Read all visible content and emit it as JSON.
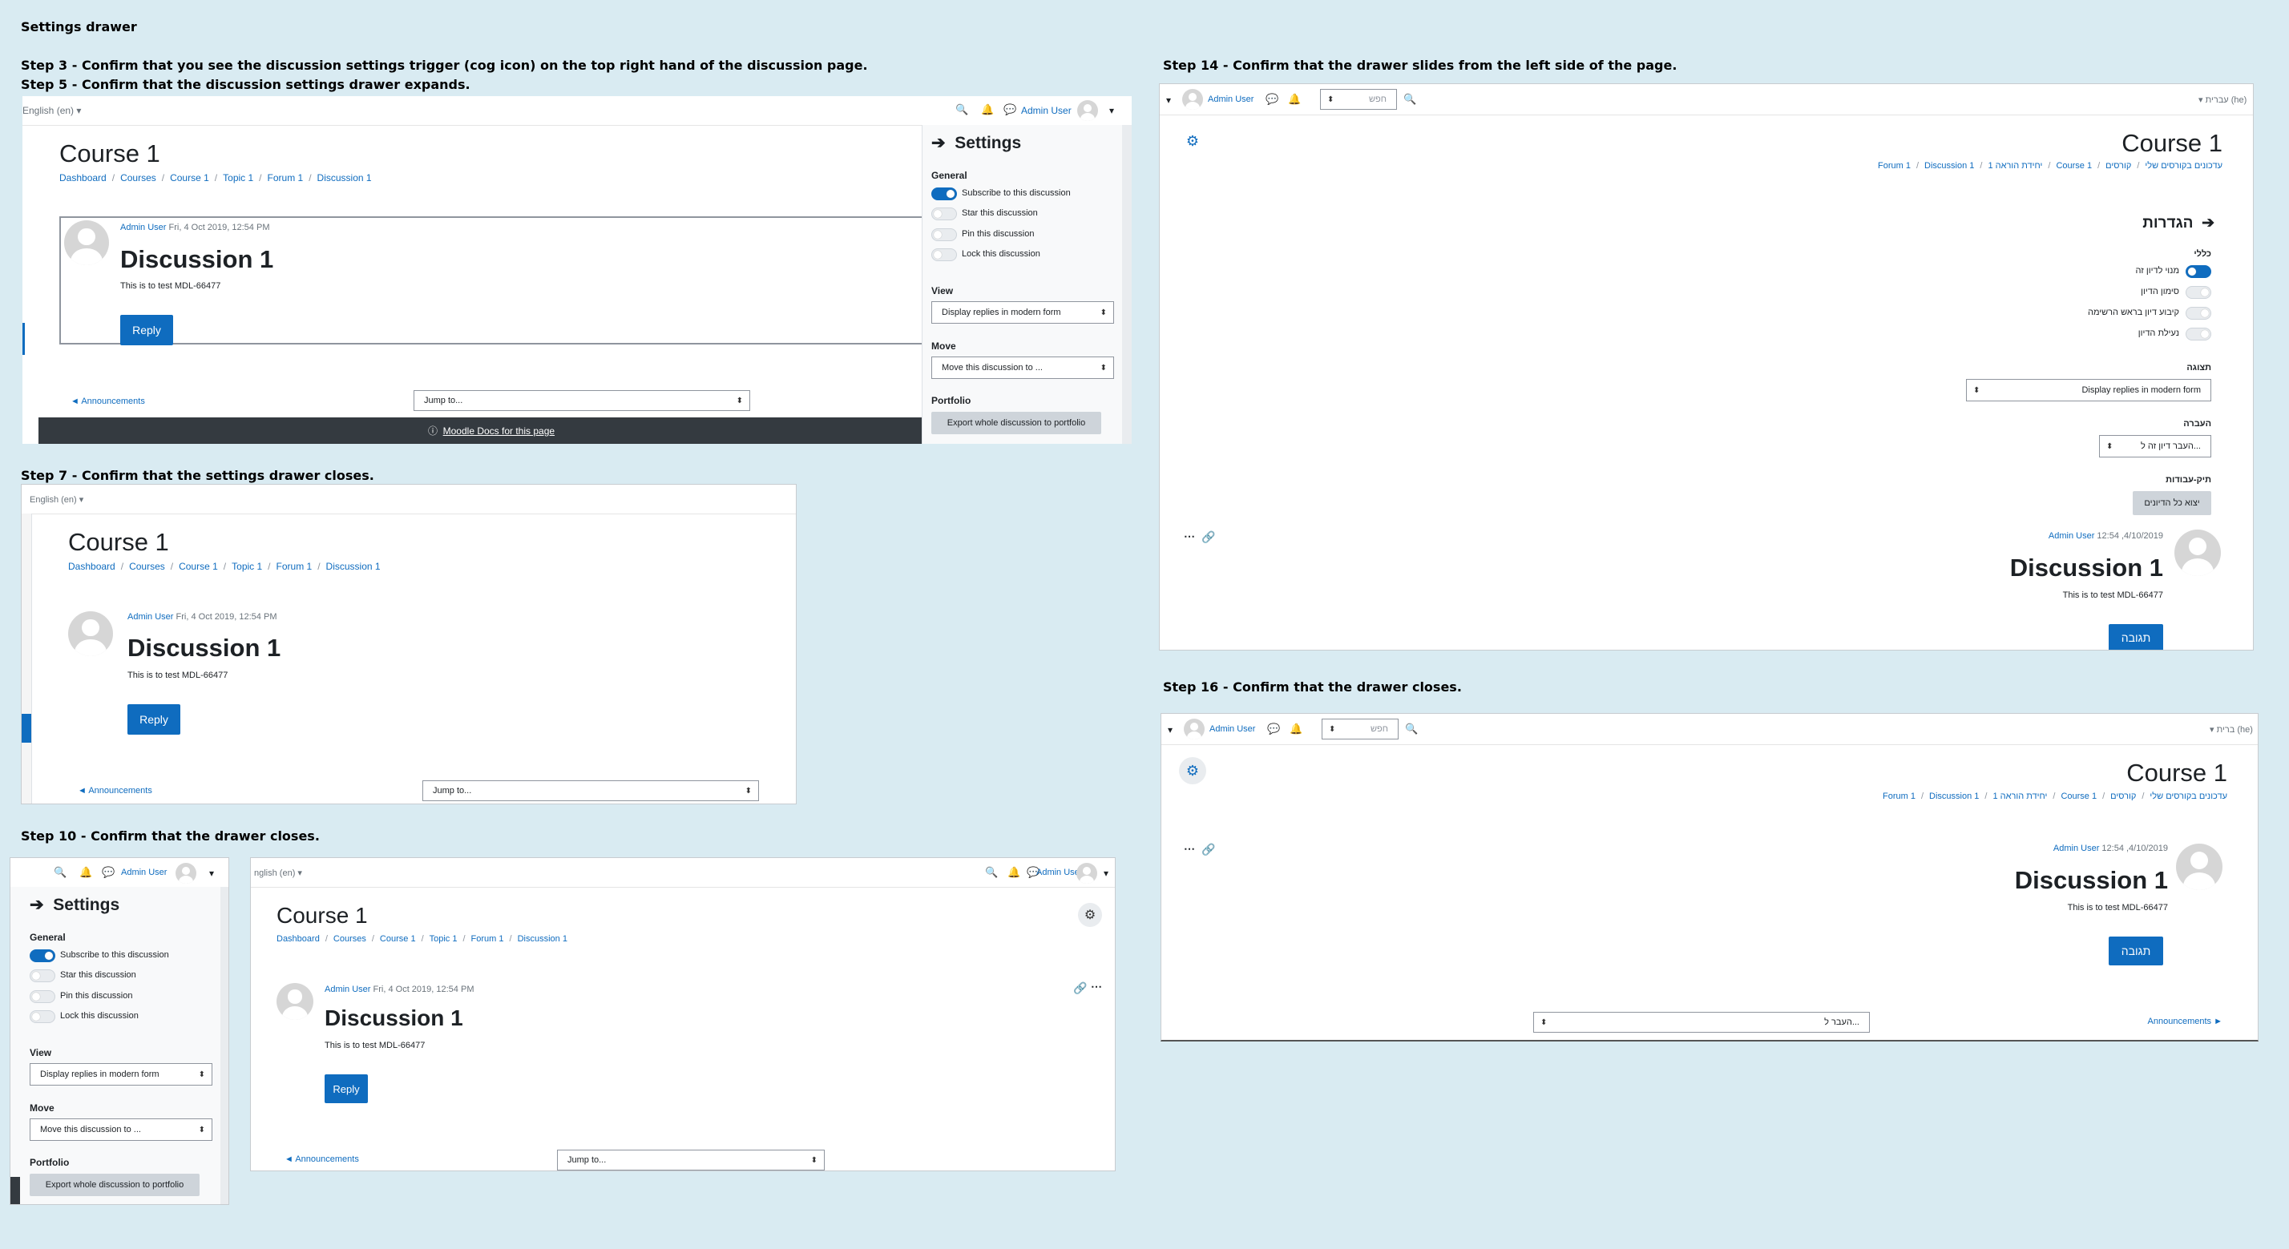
{
  "page_title": "Settings drawer",
  "captions": {
    "step3": "Step 3 - Confirm that you see the discussion settings trigger (cog icon) on the top right hand of the discussion page.",
    "step5": "Step 5 - Confirm that the discussion settings drawer expands.",
    "step7": "Step 7 - Confirm that the settings drawer closes.",
    "step10": "Step 10 - Confirm that the drawer closes.",
    "step14": "Step 14 - Confirm that the drawer slides from the left side of the page.",
    "step16": "Step 16 - Confirm that the drawer closes."
  },
  "en": {
    "language": "English (en)",
    "language_cut": "nglish (en)",
    "user": "Admin User",
    "course": "Course 1",
    "breadcrumb": [
      "Dashboard",
      "Courses",
      "Course 1",
      "Topic 1",
      "Forum 1",
      "Discussion 1"
    ],
    "post_meta": "Fri, 4 Oct 2019, 12:54 PM",
    "discussion_title": "Discussion 1",
    "post_body": "This is to test MDL-66477",
    "reply": "Reply",
    "announcements": "◄ Announcements",
    "jump_to": "Jump to...",
    "docs_link": "Moodle Docs for this page",
    "settings": {
      "title": "Settings",
      "general": "General",
      "toggles": [
        "Subscribe to this discussion",
        "Star this discussion",
        "Pin this discussion",
        "Lock this discussion"
      ],
      "view": "View",
      "view_value": "Display replies in modern form",
      "move": "Move",
      "move_value": "Move this discussion to ...",
      "portfolio": "Portfolio",
      "export": "Export whole discussion to portfolio"
    }
  },
  "he": {
    "language": "עברית (he)",
    "language_cut": "ברית (he)",
    "user": "Admin User",
    "search_placeholder": "חפש",
    "course": "Course 1",
    "breadcrumb": [
      "עדכונים בקורסים שלי",
      "קורסים",
      "Course 1",
      "יחידת הוראה 1",
      "Forum 1",
      "Discussion 1"
    ],
    "post_meta": "12:54 ,4/10/2019",
    "discussion_title": "Discussion 1",
    "post_body": "This is to test MDL-66477",
    "reply": "תגובה",
    "announcements": "Announcements ►",
    "jump_to": "...העבר ל",
    "settings": {
      "title": "הגדרות",
      "general": "כללי",
      "toggles": [
        "מנוי לדיון זה",
        "סימון הדיון",
        "קיבוע דיון בראש הרשימה",
        "נעילת הדיון"
      ],
      "view": "תצוגה",
      "view_value": "Display replies in modern form",
      "move": "העברה",
      "move_value": "...העבר דיון זה ל",
      "portfolio": "תיק-עבודות",
      "export": "יצוא כל הדיונים"
    }
  },
  "icons": {
    "search": "search-icon",
    "bell": "bell-icon",
    "chat": "chat-icon",
    "cog": "cog-icon",
    "link": "link-icon",
    "more": "more-icon",
    "arrow": "arrow-icon",
    "info": "info-icon"
  },
  "colors": {
    "accent": "#0f6cbf",
    "background": "#d9ebf2",
    "footer": "#343a40"
  }
}
